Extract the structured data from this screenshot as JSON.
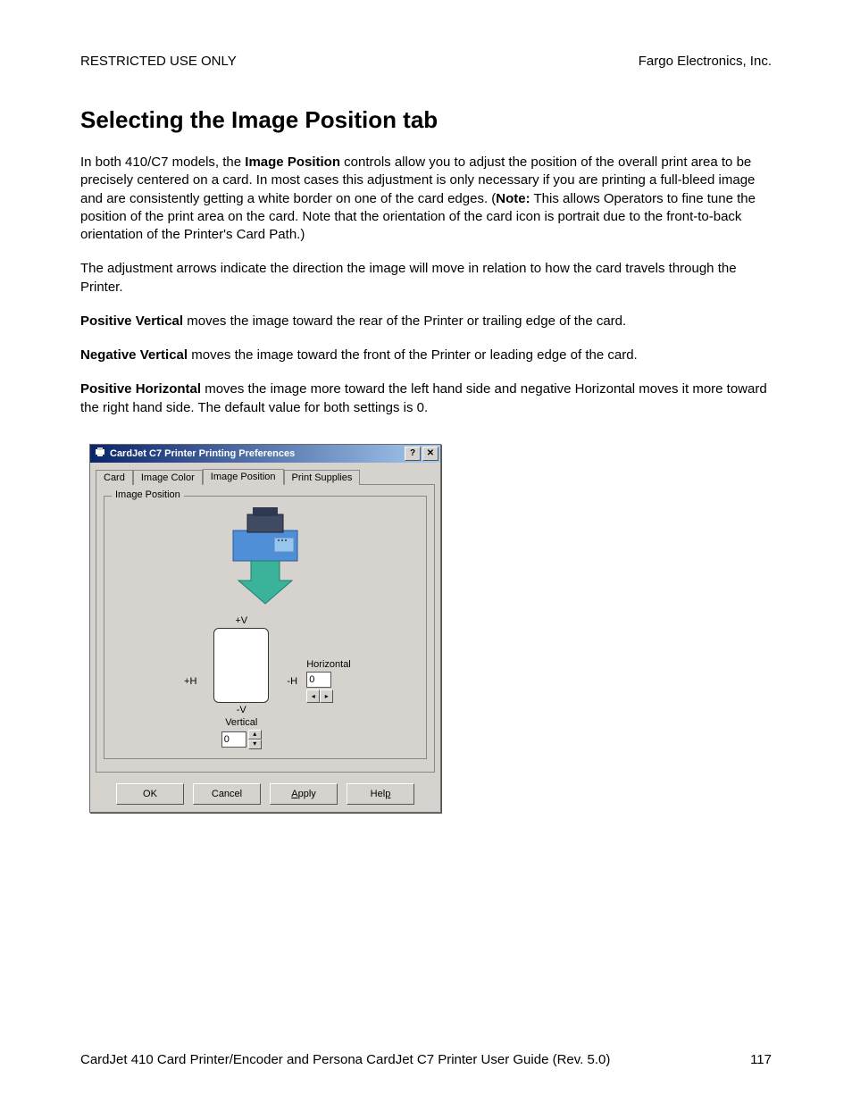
{
  "header": {
    "left": "RESTRICTED USE ONLY",
    "right": "Fargo Electronics, Inc."
  },
  "title": "Selecting the Image Position tab",
  "para1_pre": "In both 410/C7 models, the ",
  "para1_b1": "Image Position",
  "para1_mid": " controls allow you to adjust the position of the overall print area to be precisely centered on a card. In most cases this adjustment is only necessary if you are printing a full-bleed image and are consistently getting a white border on one of the card edges. (",
  "para1_b2": "Note:",
  "para1_post": "  This allows Operators to fine tune the position of the print area on the card. Note that the orientation of the card icon is portrait due to the front-to-back orientation of the Printer's Card Path.)",
  "para2": "The adjustment arrows indicate the direction the image will move in relation to how the card travels through the Printer.",
  "bullet1_b": "Positive Vertical",
  "bullet1_t": " moves the image toward the rear of the Printer or trailing edge of the card.",
  "bullet2_b": "Negative Vertical",
  "bullet2_t": " moves the image toward the front of the Printer or leading edge of the card.",
  "bullet3_b": "Positive Horizontal",
  "bullet3_t": " moves the image more toward the left hand side and negative Horizontal moves it more toward the right hand side. The default value for both settings is 0.",
  "dialog": {
    "title": "CardJet C7 Printer Printing Preferences",
    "tabs": [
      "Card",
      "Image Color",
      "Image Position",
      "Print Supplies"
    ],
    "group_label": "Image Position",
    "plusV": "+V",
    "minusV": "-V",
    "plusH": "+H",
    "minusH": "-H",
    "hlabel": "Horizontal",
    "vlabel": "Vertical",
    "hvalue": "0",
    "vvalue": "0",
    "buttons": {
      "ok": "OK",
      "cancel": "Cancel",
      "apply": "Apply",
      "help": "Help"
    }
  },
  "footer": {
    "text": "CardJet 410 Card Printer/Encoder and Persona CardJet C7 Printer User Guide (Rev. 5.0)",
    "page": "117"
  }
}
